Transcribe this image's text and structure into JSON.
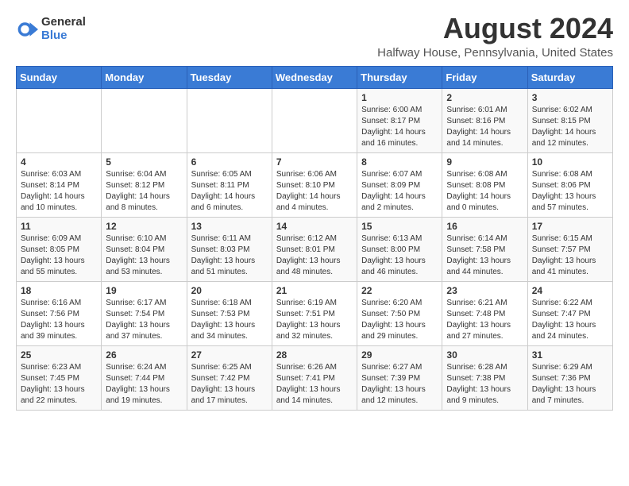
{
  "logo": {
    "general": "General",
    "blue": "Blue"
  },
  "title": "August 2024",
  "location": "Halfway House, Pennsylvania, United States",
  "weekdays": [
    "Sunday",
    "Monday",
    "Tuesday",
    "Wednesday",
    "Thursday",
    "Friday",
    "Saturday"
  ],
  "weeks": [
    [
      {
        "day": "",
        "info": ""
      },
      {
        "day": "",
        "info": ""
      },
      {
        "day": "",
        "info": ""
      },
      {
        "day": "",
        "info": ""
      },
      {
        "day": "1",
        "info": "Sunrise: 6:00 AM\nSunset: 8:17 PM\nDaylight: 14 hours\nand 16 minutes."
      },
      {
        "day": "2",
        "info": "Sunrise: 6:01 AM\nSunset: 8:16 PM\nDaylight: 14 hours\nand 14 minutes."
      },
      {
        "day": "3",
        "info": "Sunrise: 6:02 AM\nSunset: 8:15 PM\nDaylight: 14 hours\nand 12 minutes."
      }
    ],
    [
      {
        "day": "4",
        "info": "Sunrise: 6:03 AM\nSunset: 8:14 PM\nDaylight: 14 hours\nand 10 minutes."
      },
      {
        "day": "5",
        "info": "Sunrise: 6:04 AM\nSunset: 8:12 PM\nDaylight: 14 hours\nand 8 minutes."
      },
      {
        "day": "6",
        "info": "Sunrise: 6:05 AM\nSunset: 8:11 PM\nDaylight: 14 hours\nand 6 minutes."
      },
      {
        "day": "7",
        "info": "Sunrise: 6:06 AM\nSunset: 8:10 PM\nDaylight: 14 hours\nand 4 minutes."
      },
      {
        "day": "8",
        "info": "Sunrise: 6:07 AM\nSunset: 8:09 PM\nDaylight: 14 hours\nand 2 minutes."
      },
      {
        "day": "9",
        "info": "Sunrise: 6:08 AM\nSunset: 8:08 PM\nDaylight: 14 hours\nand 0 minutes."
      },
      {
        "day": "10",
        "info": "Sunrise: 6:08 AM\nSunset: 8:06 PM\nDaylight: 13 hours\nand 57 minutes."
      }
    ],
    [
      {
        "day": "11",
        "info": "Sunrise: 6:09 AM\nSunset: 8:05 PM\nDaylight: 13 hours\nand 55 minutes."
      },
      {
        "day": "12",
        "info": "Sunrise: 6:10 AM\nSunset: 8:04 PM\nDaylight: 13 hours\nand 53 minutes."
      },
      {
        "day": "13",
        "info": "Sunrise: 6:11 AM\nSunset: 8:03 PM\nDaylight: 13 hours\nand 51 minutes."
      },
      {
        "day": "14",
        "info": "Sunrise: 6:12 AM\nSunset: 8:01 PM\nDaylight: 13 hours\nand 48 minutes."
      },
      {
        "day": "15",
        "info": "Sunrise: 6:13 AM\nSunset: 8:00 PM\nDaylight: 13 hours\nand 46 minutes."
      },
      {
        "day": "16",
        "info": "Sunrise: 6:14 AM\nSunset: 7:58 PM\nDaylight: 13 hours\nand 44 minutes."
      },
      {
        "day": "17",
        "info": "Sunrise: 6:15 AM\nSunset: 7:57 PM\nDaylight: 13 hours\nand 41 minutes."
      }
    ],
    [
      {
        "day": "18",
        "info": "Sunrise: 6:16 AM\nSunset: 7:56 PM\nDaylight: 13 hours\nand 39 minutes."
      },
      {
        "day": "19",
        "info": "Sunrise: 6:17 AM\nSunset: 7:54 PM\nDaylight: 13 hours\nand 37 minutes."
      },
      {
        "day": "20",
        "info": "Sunrise: 6:18 AM\nSunset: 7:53 PM\nDaylight: 13 hours\nand 34 minutes."
      },
      {
        "day": "21",
        "info": "Sunrise: 6:19 AM\nSunset: 7:51 PM\nDaylight: 13 hours\nand 32 minutes."
      },
      {
        "day": "22",
        "info": "Sunrise: 6:20 AM\nSunset: 7:50 PM\nDaylight: 13 hours\nand 29 minutes."
      },
      {
        "day": "23",
        "info": "Sunrise: 6:21 AM\nSunset: 7:48 PM\nDaylight: 13 hours\nand 27 minutes."
      },
      {
        "day": "24",
        "info": "Sunrise: 6:22 AM\nSunset: 7:47 PM\nDaylight: 13 hours\nand 24 minutes."
      }
    ],
    [
      {
        "day": "25",
        "info": "Sunrise: 6:23 AM\nSunset: 7:45 PM\nDaylight: 13 hours\nand 22 minutes."
      },
      {
        "day": "26",
        "info": "Sunrise: 6:24 AM\nSunset: 7:44 PM\nDaylight: 13 hours\nand 19 minutes."
      },
      {
        "day": "27",
        "info": "Sunrise: 6:25 AM\nSunset: 7:42 PM\nDaylight: 13 hours\nand 17 minutes."
      },
      {
        "day": "28",
        "info": "Sunrise: 6:26 AM\nSunset: 7:41 PM\nDaylight: 13 hours\nand 14 minutes."
      },
      {
        "day": "29",
        "info": "Sunrise: 6:27 AM\nSunset: 7:39 PM\nDaylight: 13 hours\nand 12 minutes."
      },
      {
        "day": "30",
        "info": "Sunrise: 6:28 AM\nSunset: 7:38 PM\nDaylight: 13 hours\nand 9 minutes."
      },
      {
        "day": "31",
        "info": "Sunrise: 6:29 AM\nSunset: 7:36 PM\nDaylight: 13 hours\nand 7 minutes."
      }
    ]
  ]
}
